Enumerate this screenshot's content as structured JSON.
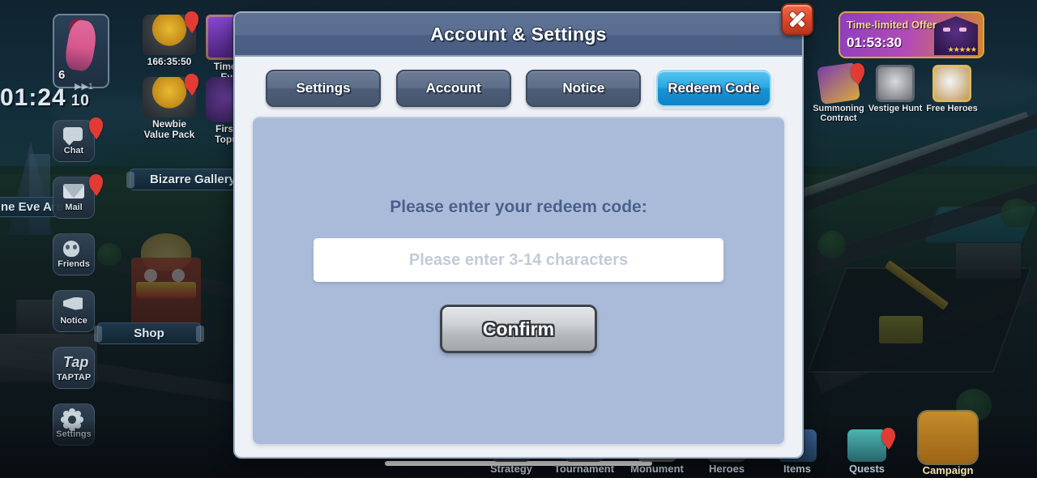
{
  "hud": {
    "player_level": "6",
    "battle_timer": "01:24",
    "battle_count": "10",
    "fast_forward": "▶▶1",
    "area_label": "ne Eve Are",
    "chests": [
      {
        "label": "166:35:50",
        "name": "gold-chest-timer"
      },
      {
        "label": "Newbie\nValue Pack",
        "name": "newbie-value-pack"
      }
    ],
    "offers_top": [
      {
        "label": "Time-li\nEve"
      },
      {
        "label": "First-t\nTopup"
      }
    ]
  },
  "sidebar": {
    "items": [
      {
        "label": "Chat",
        "icon": "chat-icon",
        "badge": true
      },
      {
        "label": "Mail",
        "icon": "mail-icon",
        "badge": true
      },
      {
        "label": "Friends",
        "icon": "friends-icon",
        "badge": false
      },
      {
        "label": "Notice",
        "icon": "megaphone-icon",
        "badge": false
      },
      {
        "label": "TAPTAP",
        "icon": "taptap-icon",
        "badge": false,
        "glyph": "Tap"
      },
      {
        "label": "Settings",
        "icon": "gear-icon",
        "badge": false
      }
    ]
  },
  "scene": {
    "plates": [
      {
        "label": "Bizarre Gallery"
      },
      {
        "label": "Shop"
      }
    ]
  },
  "offer_banner": {
    "title": "Time-limited Offer",
    "timer": "01:53:30",
    "stars": "★★★★★"
  },
  "top_right_items": [
    {
      "label": "Summoning\nContract",
      "badge": true
    },
    {
      "label": "Vestige Hunt",
      "badge": false
    },
    {
      "label": "Free Heroes",
      "badge": false
    }
  ],
  "bottom_nav": {
    "items": [
      {
        "label": "Strategy",
        "active": false
      },
      {
        "label": "Tournament",
        "active": false
      },
      {
        "label": "Monument",
        "active": false
      },
      {
        "label": "Heroes",
        "active": false
      },
      {
        "label": "Items",
        "active": false
      },
      {
        "label": "Quests",
        "active": false,
        "badge": true
      },
      {
        "label": "Campaign",
        "active": true
      }
    ]
  },
  "modal": {
    "title": "Account & Settings",
    "close_label": "Close",
    "tabs": [
      {
        "label": "Settings",
        "active": false
      },
      {
        "label": "Account",
        "active": false
      },
      {
        "label": "Notice",
        "active": false
      },
      {
        "label": "Redeem Code",
        "active": true
      }
    ],
    "redeem": {
      "prompt": "Please enter your redeem code:",
      "input_value": "",
      "input_placeholder": "Please enter 3-14 characters",
      "confirm_label": "Confirm"
    }
  },
  "colors": {
    "accent_active_tab": "#1894d6",
    "panel_bg": "#a9bbd9",
    "titlebar": "#4e6285",
    "close_button": "#d94528",
    "campaign_highlight": "#d9982d"
  }
}
